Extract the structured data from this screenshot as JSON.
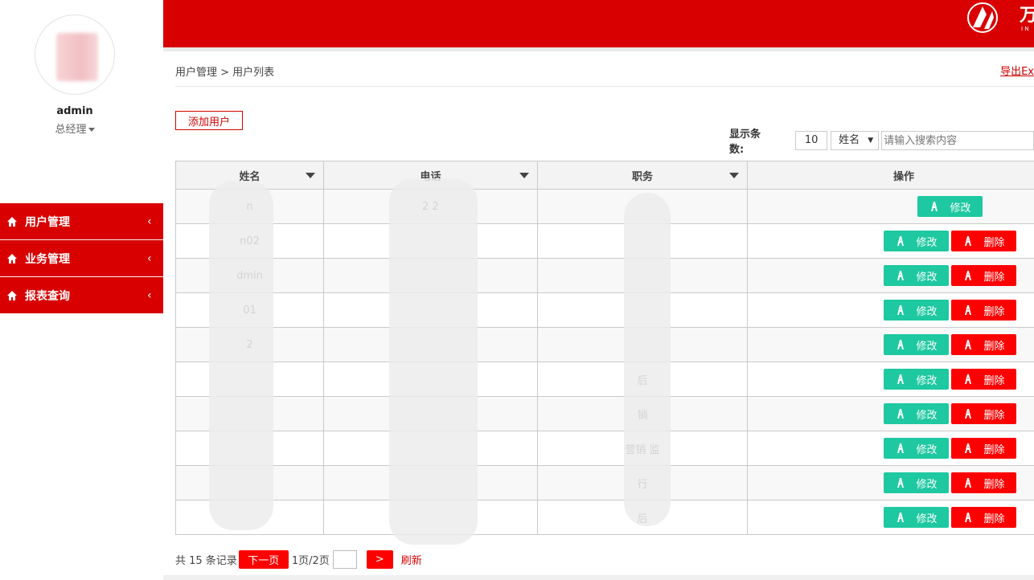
{
  "user": {
    "name": "admin",
    "role": "总经理"
  },
  "menu": [
    {
      "label": "用户管理",
      "icon": "home-icon"
    },
    {
      "label": "业务管理",
      "icon": "home-icon"
    },
    {
      "label": "报表查询",
      "icon": "home-icon"
    }
  ],
  "header": {
    "brand_color": "#d80000",
    "logo_text": "万"
  },
  "breadcrumb": "用户管理 > 用户列表",
  "export_label": "导出Ex",
  "add_user_label": "添加用户",
  "toolbar": {
    "page_size_label": "显示条数:",
    "page_size": "10",
    "field_select": "姓名",
    "search_placeholder": "请输入搜索内容"
  },
  "table": {
    "columns": [
      "姓名",
      "电话",
      "职务",
      "操作"
    ],
    "rows": [
      {
        "name": "n",
        "phone": "2       2",
        "title": "",
        "can_delete": false
      },
      {
        "name": "n02",
        "phone": "",
        "title": "",
        "can_delete": true
      },
      {
        "name": "dmin",
        "phone": "",
        "title": "",
        "can_delete": true
      },
      {
        "name": "01",
        "phone": "",
        "title": "",
        "can_delete": true
      },
      {
        "name": "2",
        "phone": "",
        "title": "",
        "can_delete": true
      },
      {
        "name": "",
        "phone": "",
        "title": "后",
        "can_delete": true
      },
      {
        "name": "",
        "phone": "",
        "title": "销",
        "can_delete": true
      },
      {
        "name": "",
        "phone": "",
        "title": "营销        监",
        "can_delete": true
      },
      {
        "name": "",
        "phone": "",
        "title": "行",
        "can_delete": true
      },
      {
        "name": "",
        "phone": "",
        "title": "后",
        "can_delete": true
      }
    ],
    "edit_label": "修改",
    "delete_label": "删除"
  },
  "pager": {
    "total_text": "共 15 条记录",
    "next_label": "下一页",
    "page_text": "1页/2页",
    "go_label": ">",
    "refresh_label": "刷新"
  }
}
